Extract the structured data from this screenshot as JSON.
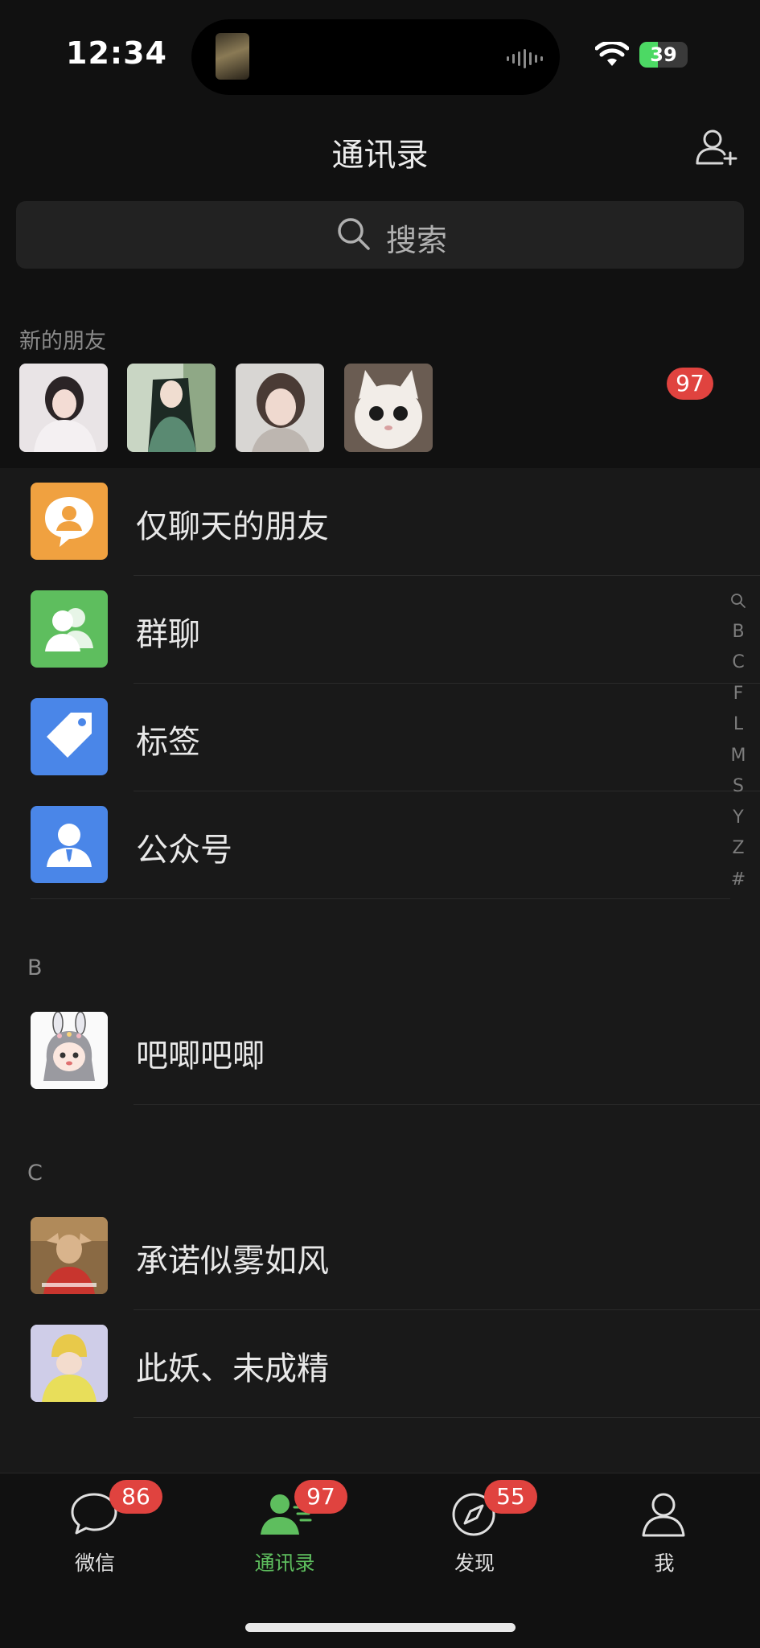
{
  "status": {
    "time": "12:34",
    "battery": "39",
    "battery_level": 0.39
  },
  "nav": {
    "title": "通讯录"
  },
  "search": {
    "placeholder": "搜索"
  },
  "new_friends": {
    "label": "新的朋友",
    "badge": "97",
    "avatars": [
      "avatar-girl-white-dress",
      "avatar-green-robe-character",
      "avatar-girl-portrait",
      "avatar-white-kitten"
    ]
  },
  "functions": [
    {
      "label": "仅聊天的朋友",
      "icon": "chat-only-friends-icon",
      "color": "#F0A140"
    },
    {
      "label": "群聊",
      "icon": "group-chat-icon",
      "color": "#5EBE5E"
    },
    {
      "label": "标签",
      "icon": "tag-icon",
      "color": "#4A86E8"
    },
    {
      "label": "公众号",
      "icon": "official-account-icon",
      "color": "#4A86E8"
    }
  ],
  "sections": [
    {
      "letter": "B",
      "contacts": [
        {
          "name": "吧唧吧唧"
        }
      ]
    },
    {
      "letter": "C",
      "contacts": [
        {
          "name": "承诺似雾如风"
        },
        {
          "name": "此妖、未成精"
        }
      ]
    }
  ],
  "index": [
    "B",
    "C",
    "F",
    "L",
    "M",
    "S",
    "Y",
    "Z",
    "#"
  ],
  "tabs": [
    {
      "label": "微信",
      "badge": "86",
      "icon": "chat-bubble-icon"
    },
    {
      "label": "通讯录",
      "badge": "97",
      "icon": "contacts-icon",
      "active": true
    },
    {
      "label": "发现",
      "badge": "55",
      "icon": "compass-icon"
    },
    {
      "label": "我",
      "badge": "",
      "icon": "person-icon"
    }
  ],
  "colors": {
    "active_tab": "#5EBE5E",
    "badge": "#E0433F",
    "background": "#191919"
  }
}
